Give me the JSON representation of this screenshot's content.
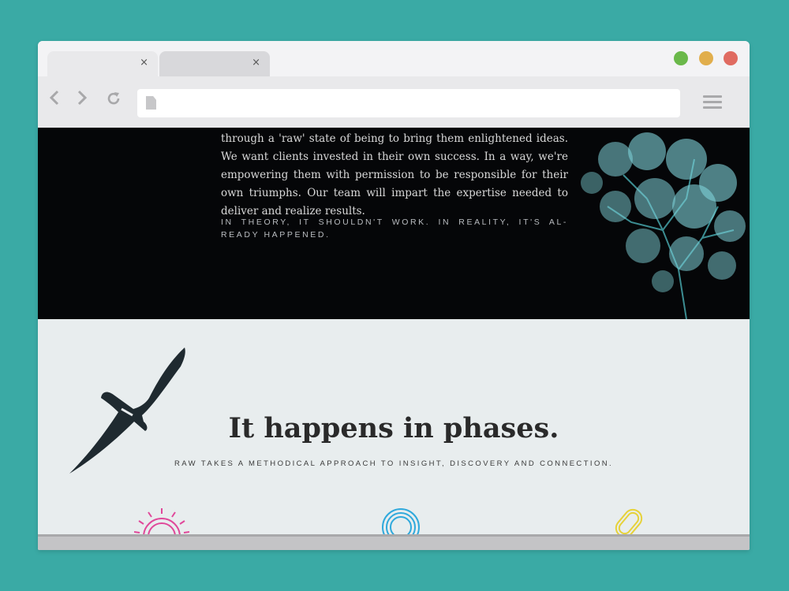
{
  "browser": {
    "tabs": [
      {
        "close_label": "×"
      },
      {
        "close_label": "×"
      }
    ],
    "nav": {
      "back_icon": "chevron-left-icon",
      "forward_icon": "chevron-right-icon",
      "reload_icon": "reload-icon",
      "menu_icon": "hamburger-menu-icon"
    },
    "address_value": "",
    "window_controls": {
      "green": "#6ab84a",
      "yellow": "#e1ae4c",
      "red": "#e06b61"
    }
  },
  "page": {
    "intro": {
      "body": "through a 'raw' state of being to bring them enlightened ideas. We want clients invested in their own success. In a way, we're empowering them with permission to be responsible for their own triumphs. Our team will impart the expertise needed to deliver and realize results.",
      "tagline": "IN THEORY, IT SHOULDN'T WORK. IN REALITY, IT'S AL- READY HAPPENED."
    },
    "phases": {
      "heading": "It happens in phases.",
      "subheading": "RAW TAKES A METHODICAL APPROACH TO INSIGHT, DISCOVERY AND CONNECTION.",
      "icons": [
        {
          "name": "sun-icon",
          "color": "#e0489a"
        },
        {
          "name": "circle-lens-icon",
          "color": "#2fa9dc"
        },
        {
          "name": "chain-link-icon",
          "color": "#e6d23a"
        }
      ]
    }
  }
}
